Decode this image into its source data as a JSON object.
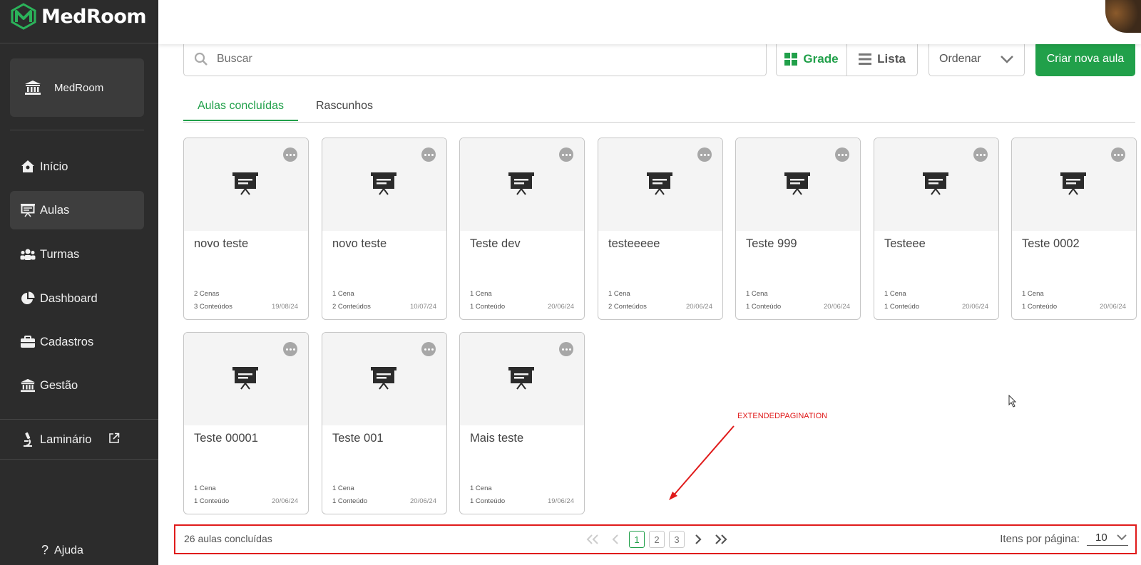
{
  "app": {
    "name": "MedRoom",
    "organization": "MedRoom"
  },
  "nav": {
    "items": [
      {
        "label": "Início",
        "icon": "home-icon"
      },
      {
        "label": "Aulas",
        "icon": "presentation-board-icon",
        "active": true
      },
      {
        "label": "Turmas",
        "icon": "users-group-icon"
      },
      {
        "label": "Dashboard",
        "icon": "pie-chart-icon"
      },
      {
        "label": "Cadastros",
        "icon": "briefcase-icon"
      },
      {
        "label": "Gestão",
        "icon": "institution-icon"
      }
    ],
    "external": {
      "label": "Laminário",
      "icon": "microscope-icon"
    },
    "help": "Ajuda"
  },
  "toolbar": {
    "search_placeholder": "Buscar",
    "view_grid": "Grade",
    "view_list": "Lista",
    "order": "Ordenar",
    "create": "Criar nova aula"
  },
  "tabs": [
    "Aulas concluídas",
    "Rascunhos"
  ],
  "cards": [
    {
      "title": "novo teste",
      "scenes": "2 Cenas",
      "contents": "3 Conteúdos",
      "date": "19/08/24"
    },
    {
      "title": "novo teste",
      "scenes": "1 Cena",
      "contents": "2 Conteúdos",
      "date": "10/07/24"
    },
    {
      "title": "Teste dev",
      "scenes": "1 Cena",
      "contents": "1 Conteúdo",
      "date": "20/06/24"
    },
    {
      "title": "testeeeee",
      "scenes": "1 Cena",
      "contents": "2 Conteúdos",
      "date": "20/06/24"
    },
    {
      "title": "Teste 999",
      "scenes": "1 Cena",
      "contents": "1 Conteúdo",
      "date": "20/06/24"
    },
    {
      "title": "Testeee",
      "scenes": "1 Cena",
      "contents": "1 Conteúdo",
      "date": "20/06/24"
    },
    {
      "title": "Teste 0002",
      "scenes": "1 Cena",
      "contents": "1 Conteúdo",
      "date": "20/06/24"
    },
    {
      "title": "Teste 00001",
      "scenes": "1 Cena",
      "contents": "1 Conteúdo",
      "date": "20/06/24"
    },
    {
      "title": "Teste 001",
      "scenes": "1 Cena",
      "contents": "1 Conteúdo",
      "date": "20/06/24"
    },
    {
      "title": "Mais teste",
      "scenes": "1 Cena",
      "contents": "1 Conteúdo",
      "date": "19/06/24"
    }
  ],
  "annotation": "EXTENDEDPAGINATION",
  "pagination": {
    "total": "26 aulas concluídas",
    "pages": [
      "1",
      "2",
      "3"
    ],
    "current": "1",
    "per_page_label": "Itens por página:",
    "per_page_value": "10"
  },
  "colors": {
    "accent": "#21a04a",
    "sidebar": "#2c2c2c",
    "annotation": "#e01b1b"
  }
}
